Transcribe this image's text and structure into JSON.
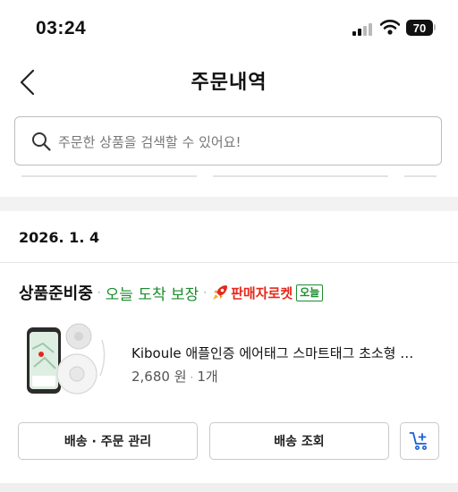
{
  "status_bar": {
    "time": "03:24",
    "battery": "70"
  },
  "header": {
    "title": "주문내역"
  },
  "search": {
    "placeholder": "주문한 상품을 검색할 수 있어요!"
  },
  "order": {
    "date": "2026. 1. 4",
    "status": "상품준비중",
    "arrival": "오늘 도착 보장",
    "rocket_label": "판매자로켓",
    "today_badge": "오늘",
    "product": {
      "name": "Kiboule 애플인증 에어태그 스마트태그 초소형 …",
      "price": "2,680 원",
      "quantity": "1개"
    },
    "buttons": {
      "manage": "배송 · 주문 관리",
      "track": "배송 조회"
    }
  },
  "colors": {
    "arrival_green": "#1b8e2d",
    "rocket_red": "#e5281c",
    "cart_blue": "#1a5fd6"
  },
  "icons": [
    "back-arrow-icon",
    "search-icon",
    "rocket-icon",
    "cart-plus-icon",
    "wifi-icon",
    "signal-icon"
  ]
}
